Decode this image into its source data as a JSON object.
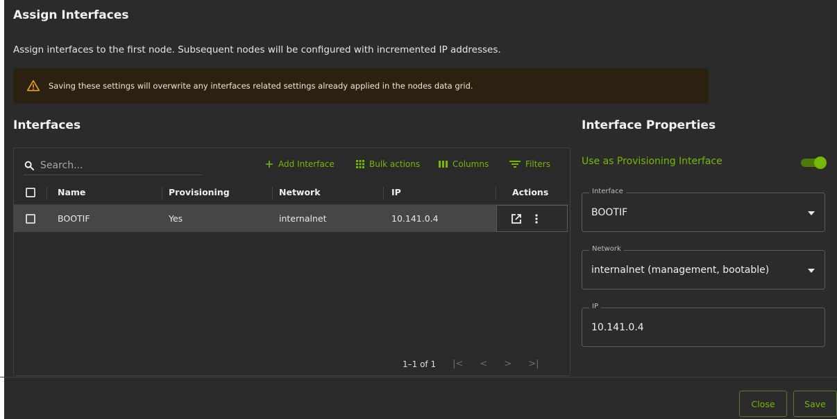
{
  "dialog": {
    "title": "Assign Interfaces",
    "description": "Assign interfaces to the first node. Subsequent nodes will be configured with incremented IP addresses.",
    "warning": "Saving these settings will overwrite any interfaces related settings already applied in the nodes data grid."
  },
  "interfaces": {
    "section_title": "Interfaces",
    "search_placeholder": "Search...",
    "toolbar": {
      "add": "Add Interface",
      "bulk": "Bulk actions",
      "columns": "Columns",
      "filters": "Filters"
    },
    "columns": [
      "Name",
      "Provisioning",
      "Network",
      "IP",
      "Actions"
    ],
    "rows": [
      {
        "name": "BOOTIF",
        "provisioning": "Yes",
        "network": "internalnet",
        "ip": "10.141.0.4"
      }
    ],
    "pagination": "1–1 of 1"
  },
  "properties": {
    "section_title": "Interface Properties",
    "provisioning_toggle_label": "Use as Provisioning Interface",
    "provisioning_toggle_on": true,
    "interface_label": "Interface",
    "interface_value": "BOOTIF",
    "network_label": "Network",
    "network_value": "internalnet (management, bootable)",
    "ip_label": "IP",
    "ip_value": "10.141.0.4"
  },
  "footer": {
    "close": "Close",
    "save": "Save"
  },
  "colors": {
    "accent": "#76b900",
    "background": "#2b2b2b",
    "warning_bg": "#2b2111",
    "warning_icon": "#f0a500"
  }
}
